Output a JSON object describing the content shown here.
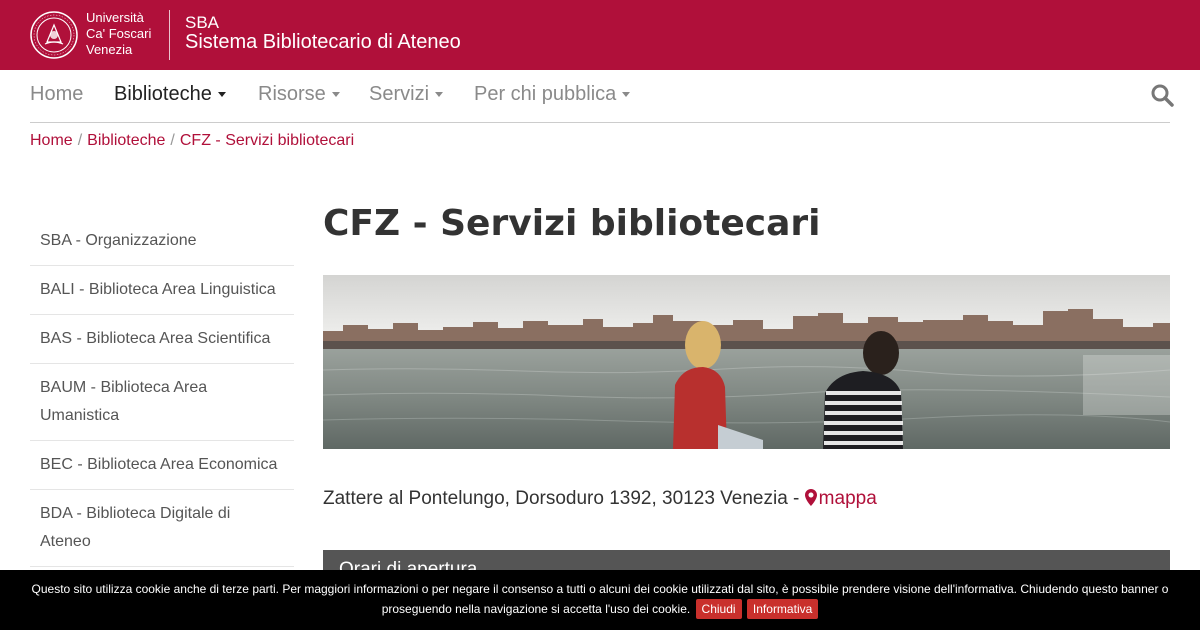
{
  "header": {
    "university_lines": [
      "Università",
      "Ca' Foscari",
      "Venezia"
    ],
    "sba_short": "SBA",
    "sba_long": "Sistema Bibliotecario di Ateneo",
    "brand_color": "#b0103a"
  },
  "nav": {
    "items": [
      {
        "label": "Home",
        "dropdown": false,
        "active": false
      },
      {
        "label": "Biblioteche",
        "dropdown": true,
        "active": true
      },
      {
        "label": "Risorse",
        "dropdown": true,
        "active": false
      },
      {
        "label": "Servizi",
        "dropdown": true,
        "active": false
      },
      {
        "label": "Per chi pubblica",
        "dropdown": true,
        "active": false
      }
    ],
    "search_icon": "search-icon"
  },
  "breadcrumb": {
    "items": [
      "Home",
      "Biblioteche",
      "CFZ - Servizi bibliotecari"
    ],
    "separator": "/"
  },
  "sidebar": {
    "items": [
      "SBA - Organizzazione",
      "BALI - Biblioteca Area Linguistica",
      "BAS - Biblioteca Area Scientifica",
      "BAUM - Biblioteca Area Umanistica",
      "BEC - Biblioteca Area Economica",
      "BDA - Biblioteca Digitale di Ateneo"
    ]
  },
  "main": {
    "title": "CFZ - Servizi bibliotecari",
    "address": "Zattere al Pontelungo, Dorsoduro 1392, 30123 Venezia - ",
    "map_label": "mappa",
    "map_icon": "map-marker-icon",
    "hours_title": "Orari di apertura"
  },
  "cookie": {
    "text": "Questo sito utilizza cookie anche di terze parti. Per maggiori informazioni o per negare il consenso a tutti o alcuni dei cookie utilizzati dal sito, è possibile prendere visione dell'informativa. Chiudendo questo banner o proseguendo nella navigazione si accetta l'uso dei cookie.",
    "close_label": "Chiudi",
    "info_label": "Informativa"
  }
}
